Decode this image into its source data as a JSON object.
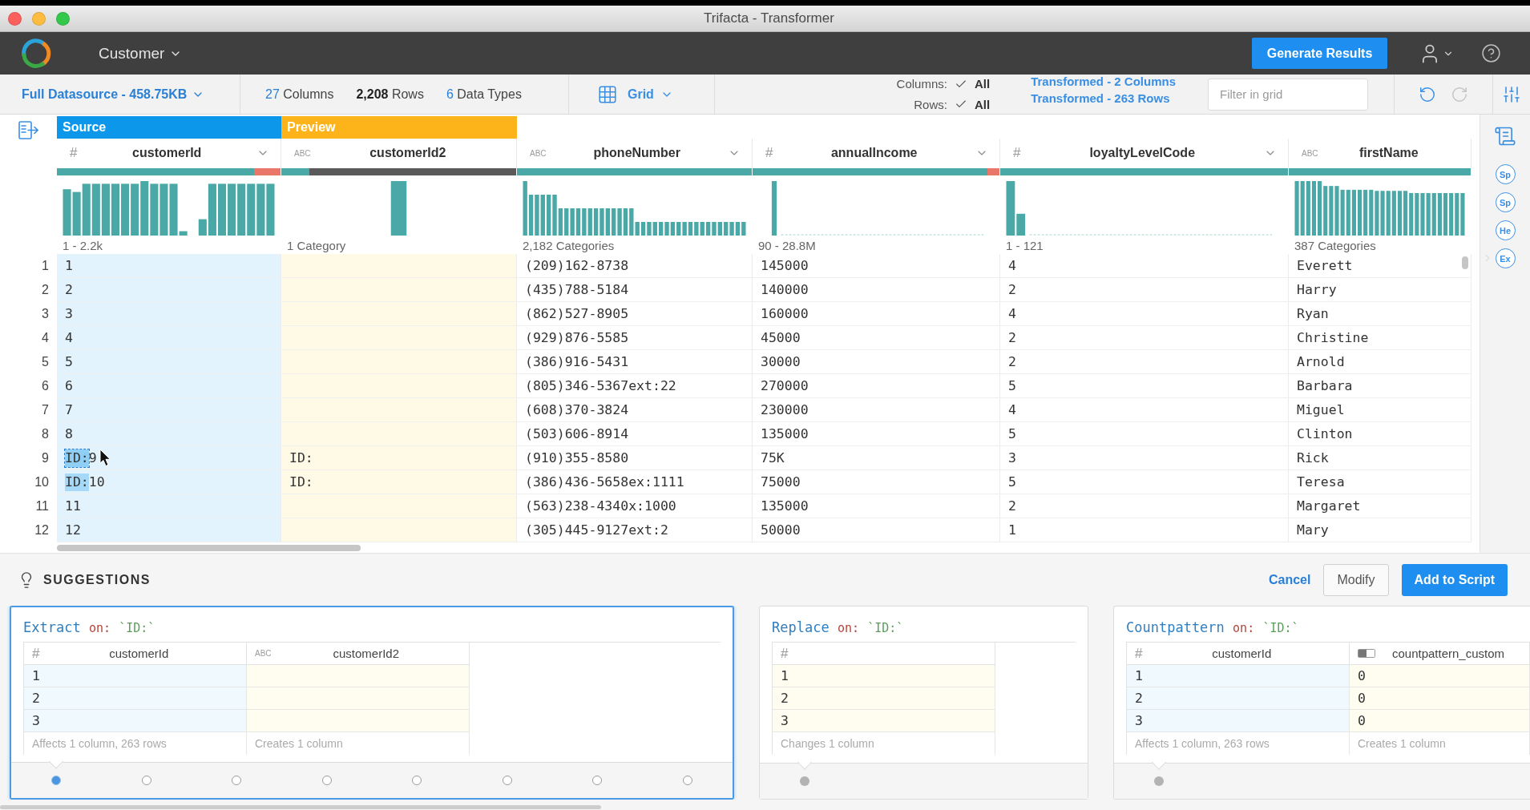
{
  "window": {
    "title": "Trifacta - Transformer"
  },
  "header": {
    "dataset": "Customer",
    "primary_button": "Generate Results"
  },
  "toolbar": {
    "datasource": "Full Datasource - 458.75KB",
    "stats": [
      {
        "number": "27",
        "unit": "Columns",
        "kind": "link"
      },
      {
        "number": "2,208",
        "unit": "Rows",
        "kind": "count"
      },
      {
        "number": "6",
        "unit": "Data Types",
        "kind": "link"
      }
    ],
    "view": "Grid",
    "selection": [
      {
        "label": "Columns:",
        "value": "All",
        "checked": true
      },
      {
        "label": "Rows:",
        "value": "All",
        "checked": true
      }
    ],
    "transformed": [
      "Transformed - 2 Columns",
      "Transformed - 263 Rows"
    ],
    "filter": {
      "placeholder": "Filter in grid"
    },
    "history": [
      {
        "kind": "undo",
        "disabled": false
      },
      {
        "kind": "redo",
        "disabled": true
      }
    ]
  },
  "grid": {
    "columns": [
      {
        "name": "customerId",
        "kind": "number",
        "type_label": "#",
        "band": {
          "label": "Source",
          "kind": "source"
        },
        "dropdown": true,
        "quality": [
          {
            "kind": "valid",
            "level": 0.88
          },
          {
            "kind": "mismatched",
            "level": 0.12
          }
        ],
        "range": "1 - 2.2k"
      },
      {
        "name": "customerId2",
        "kind": "text",
        "type_label": "ABC",
        "band": {
          "label": "Preview",
          "kind": "preview"
        },
        "dropdown": false,
        "quality": [
          {
            "kind": "valid",
            "level": 0.12
          },
          {
            "kind": "missing",
            "level": 0.88
          }
        ],
        "range": "1 Category"
      },
      {
        "name": "phoneNumber",
        "kind": "text",
        "type_label": "ABC",
        "dropdown": true,
        "quality": [
          {
            "kind": "valid",
            "level": 1
          }
        ],
        "range": "2,182 Categories"
      },
      {
        "name": "annualIncome",
        "kind": "number",
        "type_label": "#",
        "dropdown": true,
        "quality": [
          {
            "kind": "valid",
            "level": 0.95
          },
          {
            "kind": "mismatched",
            "level": 0.05
          }
        ],
        "range": "90 - 28.8M"
      },
      {
        "name": "loyaltyLevelCode",
        "kind": "number",
        "type_label": "#",
        "dropdown": true,
        "quality": [
          {
            "kind": "valid",
            "level": 1
          }
        ],
        "range": "1 - 121"
      },
      {
        "name": "firstName",
        "kind": "text",
        "type_label": "ABC",
        "dropdown": false,
        "quality": [
          {
            "kind": "valid",
            "level": 1
          }
        ],
        "range": "387 Categories"
      }
    ],
    "rows": [
      {
        "number": "1",
        "cells": [
          "1",
          null,
          "(209)162-8738",
          "145000",
          "4",
          "Everett"
        ]
      },
      {
        "number": "2",
        "cells": [
          "2",
          null,
          "(435)788-5184",
          "140000",
          "2",
          "Harry"
        ]
      },
      {
        "number": "3",
        "cells": [
          "3",
          null,
          "(862)527-8905",
          "160000",
          "4",
          "Ryan"
        ]
      },
      {
        "number": "4",
        "cells": [
          "4",
          null,
          "(929)876-5585",
          "45000",
          "2",
          "Christine"
        ]
      },
      {
        "number": "5",
        "cells": [
          "5",
          null,
          "(386)916-5431",
          "30000",
          "2",
          "Arnold"
        ]
      },
      {
        "number": "6",
        "cells": [
          "6",
          null,
          "(805)346-5367ext:22",
          "270000",
          "5",
          "Barbara"
        ]
      },
      {
        "number": "7",
        "cells": [
          "7",
          null,
          "(608)370-3824",
          "230000",
          "4",
          "Miguel"
        ]
      },
      {
        "number": "8",
        "cells": [
          "8",
          null,
          "(503)606-8914",
          "135000",
          "5",
          "Clinton"
        ]
      },
      {
        "number": "9",
        "cells": [
          {
            "parts": [
              {
                "text": "ID:",
                "kind": "selection"
              },
              {
                "text": "9",
                "kind": "plain"
              }
            ]
          },
          "ID:",
          "(910)355-8580",
          "75K",
          "3",
          "Rick"
        ]
      },
      {
        "number": "10",
        "cells": [
          {
            "parts": [
              {
                "text": "ID:",
                "kind": "match"
              },
              {
                "text": "10",
                "kind": "plain"
              }
            ]
          },
          "ID:",
          "(386)436-5658ex:1111",
          "75000",
          "5",
          "Teresa"
        ]
      },
      {
        "number": "11",
        "cells": [
          "11",
          null,
          "(563)238-4340x:1000",
          "135000",
          "2",
          "Margaret"
        ]
      },
      {
        "number": "12",
        "cells": [
          "12",
          null,
          "(305)445-9127ext:2",
          "50000",
          "1",
          "Mary"
        ]
      }
    ]
  },
  "sidebar": {
    "tools": [
      "Sp",
      "Sp",
      "He",
      "Ex"
    ]
  },
  "suggestions": {
    "title": "SUGGESTIONS",
    "actions": [
      {
        "label": "Cancel",
        "kind": "link"
      },
      {
        "label": "Modify",
        "kind": "secondary"
      },
      {
        "label": "Add to Script",
        "kind": "primary"
      }
    ],
    "cards": [
      {
        "selected": true,
        "title": {
          "verb": "Extract",
          "keyword": "on:",
          "argument": "`ID:`"
        },
        "columns": [
          {
            "kind": "number",
            "type_label": "#",
            "name": "customerId",
            "band": {
              "kind": "source"
            }
          },
          {
            "kind": "text",
            "type_label": "ABC",
            "name": "customerId2",
            "band": {
              "kind": "preview"
            }
          }
        ],
        "rows": [
          [
            "1",
            null
          ],
          [
            "2",
            null
          ],
          [
            "3",
            null
          ]
        ],
        "notes": [
          "Affects 1 column, 263 rows",
          "Creates 1 column"
        ],
        "pager": [
          {
            "selected": true
          },
          {
            "selected": false
          },
          {
            "selected": false
          },
          {
            "selected": false
          },
          {
            "selected": false
          },
          {
            "selected": false
          },
          {
            "selected": false
          },
          {
            "selected": false
          }
        ]
      },
      {
        "selected": false,
        "title": {
          "verb": "Replace",
          "keyword": "on:",
          "argument": "`ID:`"
        },
        "columns": [
          {
            "kind": "number",
            "type_label": "#",
            "band": {
              "kind": "preview"
            }
          }
        ],
        "rows": [
          [
            "1"
          ],
          [
            "2"
          ],
          [
            "3"
          ]
        ],
        "notes": [
          "Changes 1 column"
        ],
        "pager": [
          {
            "selected": true
          }
        ]
      },
      {
        "selected": false,
        "title": {
          "verb": "Countpattern",
          "keyword": "on:",
          "argument": "`ID:`"
        },
        "columns": [
          {
            "kind": "number",
            "type_label": "#",
            "name": "customerId",
            "band": {
              "kind": "source"
            }
          },
          {
            "kind": "boolean",
            "name": "countpattern_custom",
            "band": {
              "kind": "preview"
            }
          }
        ],
        "rows": [
          [
            "1",
            "0"
          ],
          [
            "2",
            "0"
          ],
          [
            "3",
            "0"
          ]
        ],
        "notes": [
          "Affects 1 column, 263 rows",
          "Creates 1 column"
        ],
        "pager": [
          {
            "selected": true
          }
        ]
      }
    ]
  }
}
